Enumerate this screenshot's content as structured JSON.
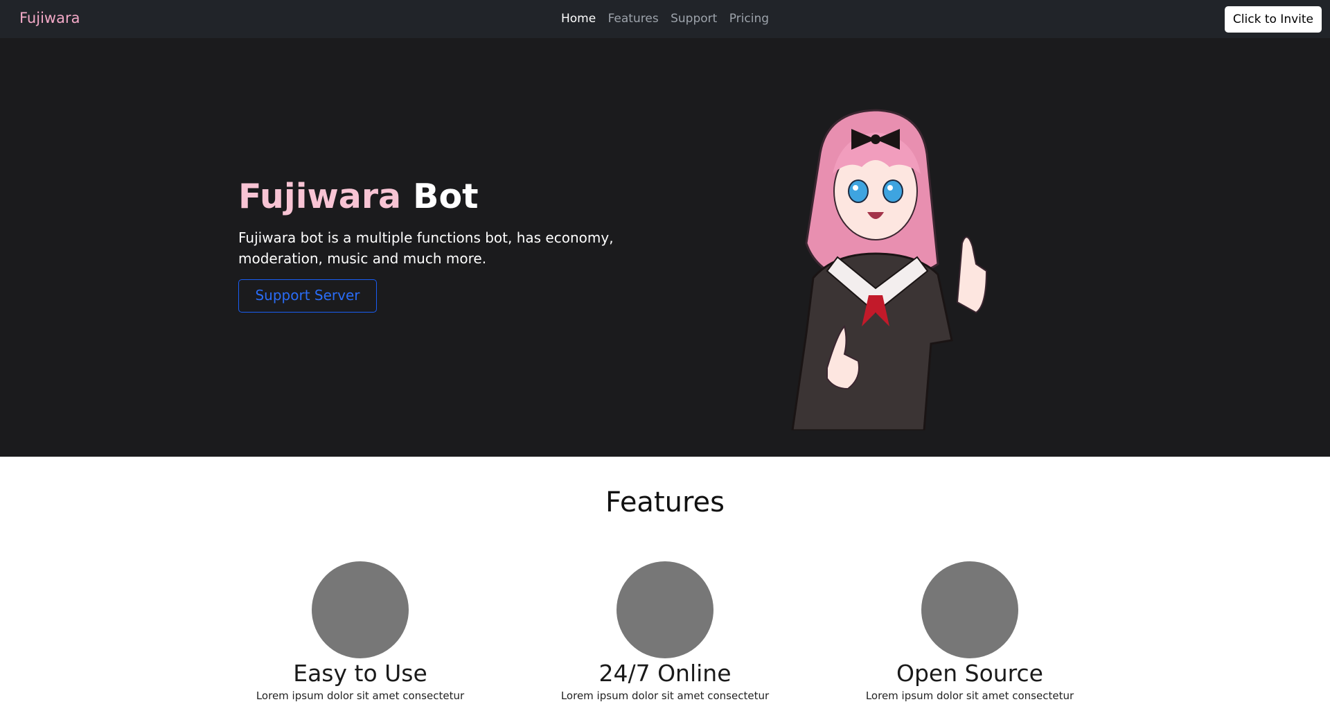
{
  "navbar": {
    "brand": "Fujiwara",
    "links": [
      {
        "label": "Home"
      },
      {
        "label": "Features"
      },
      {
        "label": "Support"
      },
      {
        "label": "Pricing"
      }
    ],
    "invite_label": "Click to Invite"
  },
  "hero": {
    "title_pink": "Fujiwara",
    "title_white": "Bot",
    "description": "Fujiwara bot is a multiple functions bot, has economy, moderation, music and much more.",
    "button_label": "Support Server"
  },
  "features": {
    "title": "Features",
    "items": [
      {
        "title": "Easy to Use",
        "text": "Lorem ipsum dolor sit amet consectetur"
      },
      {
        "title": "24/7 Online",
        "text": "Lorem ipsum dolor sit amet consectetur"
      },
      {
        "title": "Open Source",
        "text": "Lorem ipsum dolor sit amet consectetur"
      }
    ]
  },
  "colors": {
    "brand": "#f3a9c7",
    "hero_bg": "#1b1b1d",
    "accent": "#1a5ef5"
  }
}
